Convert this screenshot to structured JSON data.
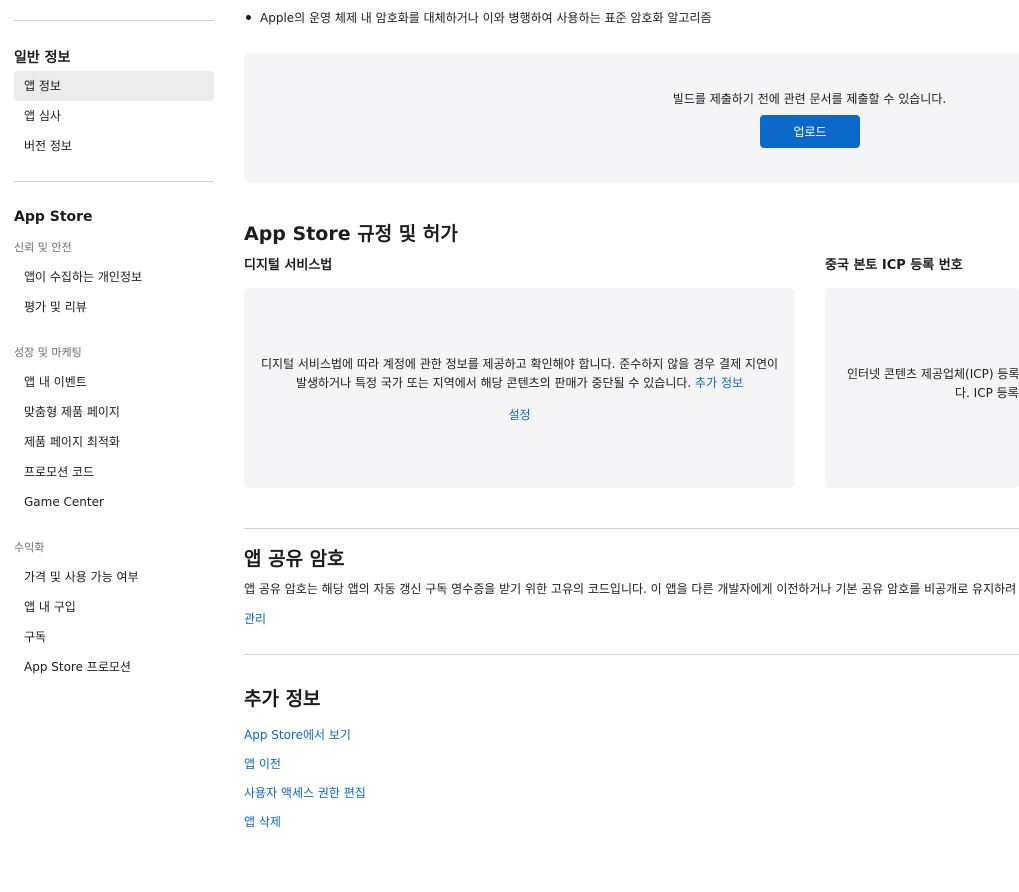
{
  "sidebar": {
    "general_heading": "일반 정보",
    "general_items": [
      "앱 정보",
      "앱 심사",
      "버전 정보"
    ],
    "appstore_heading": "App Store",
    "trust_heading": "신뢰 및 안전",
    "trust_items": [
      "앱이 수집하는 개인정보",
      "평가 및 리뷰"
    ],
    "growth_heading": "성장 및 마케팅",
    "growth_items": [
      "앱 내 이벤트",
      "맞춤형 제품 페이지",
      "제품 페이지 최적화",
      "프로모션 코드",
      "Game Center"
    ],
    "monetize_heading": "수익화",
    "monetize_items": [
      "가격 및 사용 가능 여부",
      "앱 내 구입",
      "구독",
      "App Store 프로모션"
    ]
  },
  "main": {
    "bullet_text": "Apple의 운영 체제 내 암호화를 대체하거나 이와 병행하여 사용하는 표준 암호화 알고리즘",
    "upload_text": "빌드를 제출하기 전에 관련 문서를 제출할 수 있습니다.",
    "upload_button": "업로드",
    "regulations_title": "App Store 규정 및 허가",
    "dsa_title": "디지털 서비스법",
    "dsa_text": "디지털 서비스법에 따라 계정에 관한 정보를 제공하고 확인해야 합니다. 준수하지 않을 경우 결제 지연이 발생하거나 특정 국가 또는 지역에서 해당 콘텐츠의 판매가 중단될 수 있습니다.",
    "dsa_more_link": "추가 정보",
    "dsa_setup_link": "설정",
    "icp_title": "중국 본토 ICP 등록 번호",
    "icp_text_line1": "인터넷 콘텐츠 제공업체(ICP) 등록",
    "icp_text_line2": "다. ICP 등록 번",
    "shared_secret_title": "앱 공유 암호",
    "shared_secret_text": "앱 공유 암호는 해당 앱의 자동 갱신 구독 영수증을 받기 위한 고유의 코드입니다. 이 앱을 다른 개발자에게 이전하거나 기본 공유 암호를 비공개로 유지하려",
    "manage_link": "관리",
    "more_info_title": "추가 정보",
    "more_links": [
      "App Store에서 보기",
      "앱 이전",
      "사용자 액세스 권한 편집",
      "앱 삭제"
    ]
  }
}
